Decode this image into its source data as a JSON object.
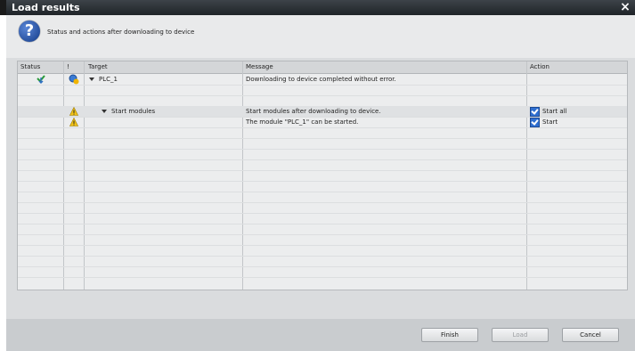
{
  "dialog": {
    "title": "Load results",
    "close_glyph": "×",
    "header_text": "Status and actions after downloading to device",
    "help_icon": "?"
  },
  "table": {
    "columns": [
      "Status",
      "!",
      "Target",
      "Message",
      "Action"
    ],
    "rows": [
      {
        "status_icon": "download-ok-icon",
        "error_icon": "device-check-icon",
        "target": "PLC_1",
        "message": "Downloading to device completed without error.",
        "action": ""
      },
      {
        "status_icon": "",
        "error_icon": "",
        "target": "",
        "message": "",
        "action": ""
      },
      {
        "status_icon": "",
        "error_icon": "warning-icon",
        "target": "Start modules",
        "message": "Start modules after downloading to device.",
        "action": "Start all",
        "action_checked": true
      },
      {
        "status_icon": "",
        "error_icon": "warning-icon",
        "target": "",
        "message": "The module \"PLC_1\" can be started.",
        "action": "Start",
        "action_checked": true
      }
    ]
  },
  "buttons": {
    "finish": "Finish",
    "load": "Load",
    "cancel": "Cancel"
  },
  "colors": {
    "titlebar": "#1f2428",
    "checkbox": "#2f6fd1",
    "warning": "#f2c318"
  }
}
